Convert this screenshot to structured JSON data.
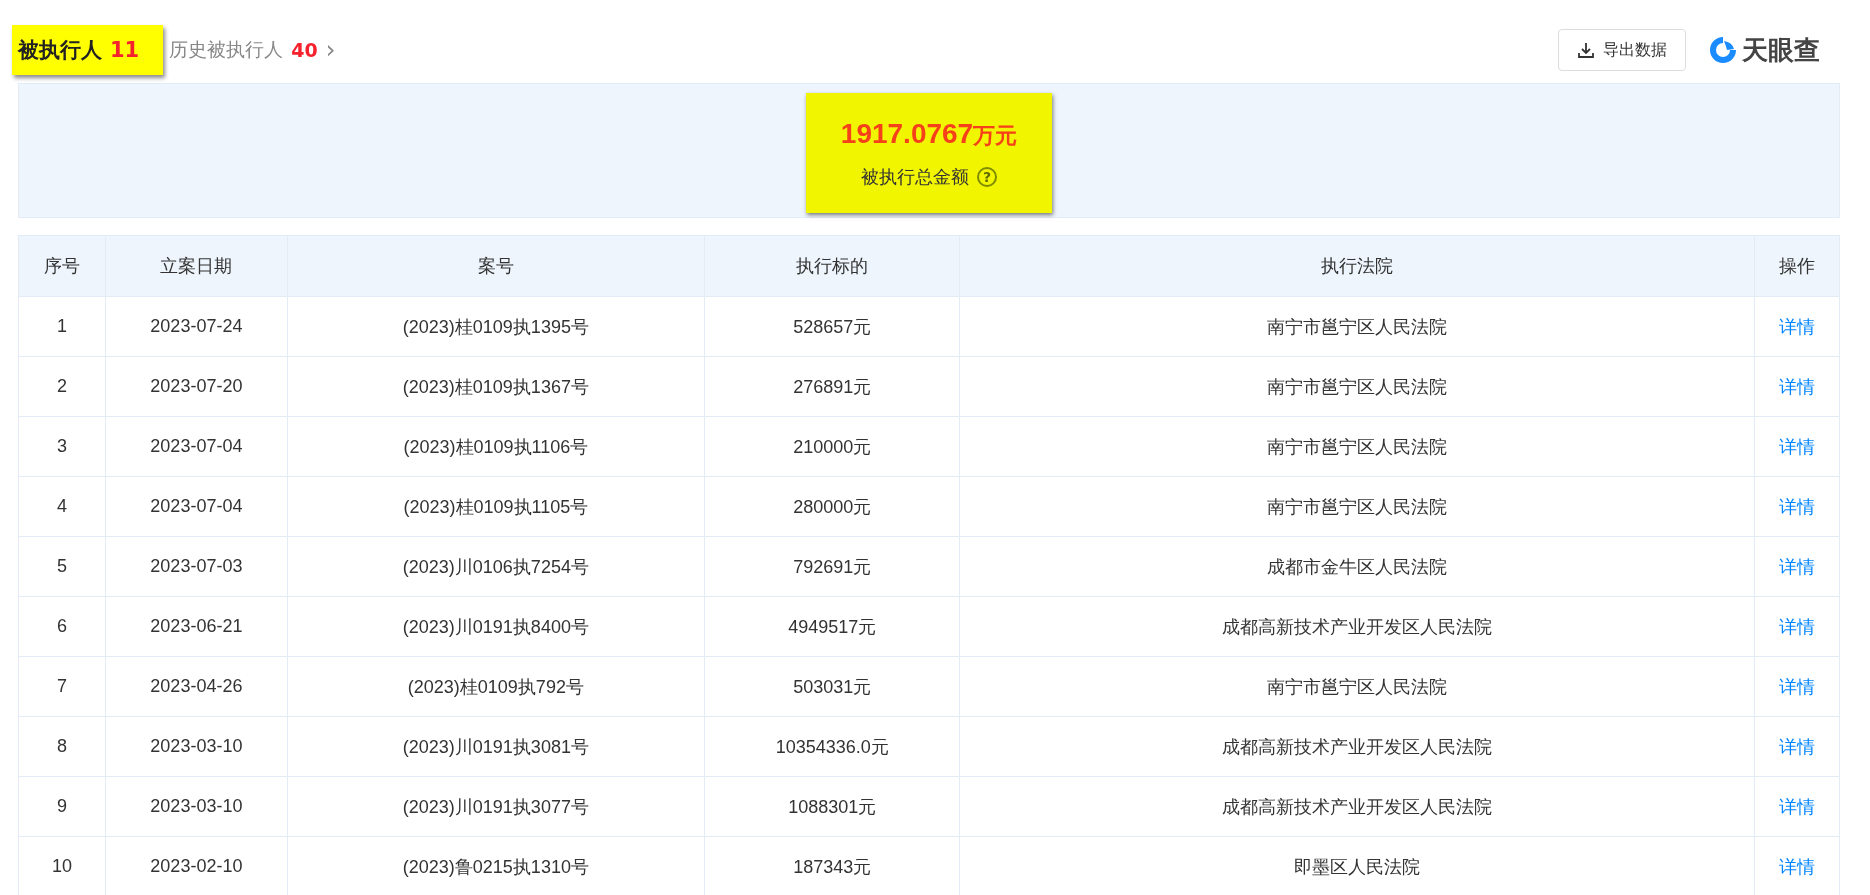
{
  "tabs": [
    {
      "label": "被执行人",
      "count": "11",
      "selected": true
    },
    {
      "label": "历史被执行人",
      "count": "40",
      "selected": false,
      "arrow": "›"
    }
  ],
  "export_button": "导出数据",
  "logo": "天眼查",
  "summary": {
    "amount": "1917.0767",
    "unit": "万元",
    "label": "被执行总金额",
    "help": "?"
  },
  "table": {
    "columns": [
      "序号",
      "立案日期",
      "案号",
      "执行标的",
      "执行法院",
      "操作"
    ],
    "rows": [
      {
        "no": "1",
        "date": "2023-07-24",
        "case": "(2023)桂0109执1395号",
        "amount": "528657元",
        "court": "南宁市邕宁区人民法院",
        "action": "详情"
      },
      {
        "no": "2",
        "date": "2023-07-20",
        "case": "(2023)桂0109执1367号",
        "amount": "276891元",
        "court": "南宁市邕宁区人民法院",
        "action": "详情"
      },
      {
        "no": "3",
        "date": "2023-07-04",
        "case": "(2023)桂0109执1106号",
        "amount": "210000元",
        "court": "南宁市邕宁区人民法院",
        "action": "详情"
      },
      {
        "no": "4",
        "date": "2023-07-04",
        "case": "(2023)桂0109执1105号",
        "amount": "280000元",
        "court": "南宁市邕宁区人民法院",
        "action": "详情"
      },
      {
        "no": "5",
        "date": "2023-07-03",
        "case": "(2023)川0106执7254号",
        "amount": "792691元",
        "court": "成都市金牛区人民法院",
        "action": "详情"
      },
      {
        "no": "6",
        "date": "2023-06-21",
        "case": "(2023)川0191执8400号",
        "amount": "4949517元",
        "court": "成都高新技术产业开发区人民法院",
        "action": "详情"
      },
      {
        "no": "7",
        "date": "2023-04-26",
        "case": "(2023)桂0109执792号",
        "amount": "503031元",
        "court": "南宁市邕宁区人民法院",
        "action": "详情"
      },
      {
        "no": "8",
        "date": "2023-03-10",
        "case": "(2023)川0191执3081号",
        "amount": "10354336.0元",
        "court": "成都高新技术产业开发区人民法院",
        "action": "详情"
      },
      {
        "no": "9",
        "date": "2023-03-10",
        "case": "(2023)川0191执3077号",
        "amount": "1088301元",
        "court": "成都高新技术产业开发区人民法院",
        "action": "详情"
      },
      {
        "no": "10",
        "date": "2023-02-10",
        "case": "(2023)鲁0215执1310号",
        "amount": "187343元",
        "court": "即墨区人民法院",
        "action": "详情"
      }
    ]
  }
}
